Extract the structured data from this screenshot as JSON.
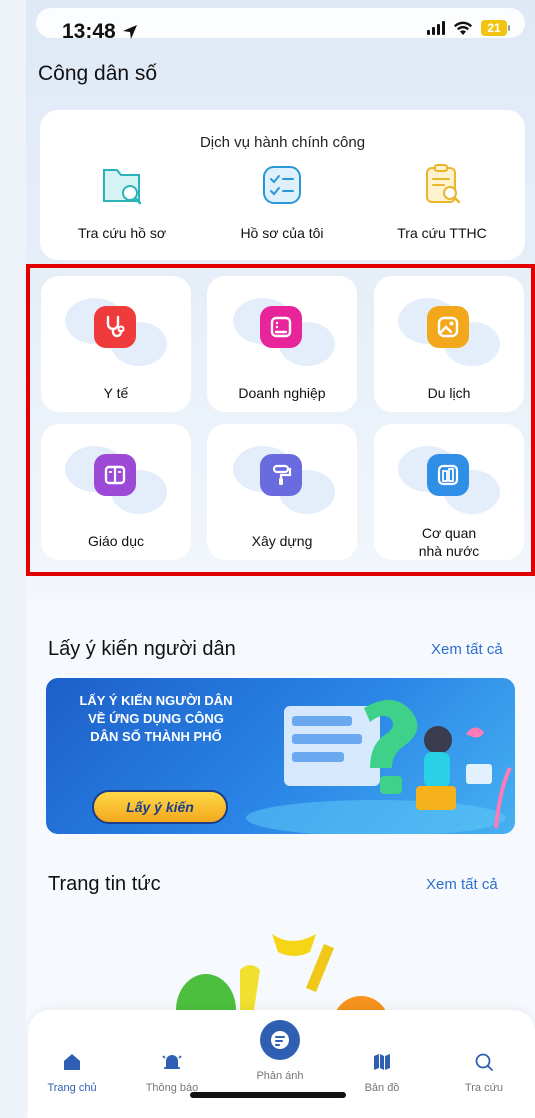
{
  "status_bar": {
    "time": "13:48",
    "battery": "21"
  },
  "header": {
    "title": "Công dân số"
  },
  "public_services": {
    "title": "Dịch vụ hành chính công",
    "items": [
      {
        "label": "Tra cứu hồ sơ",
        "icon": "folder-search-icon"
      },
      {
        "label": "Hồ sơ của tôi",
        "icon": "checklist-icon"
      },
      {
        "label": "Tra cứu TTHC",
        "icon": "clipboard-search-icon"
      }
    ]
  },
  "categories": [
    {
      "label": "Y tế",
      "icon": "stethoscope-icon",
      "color": "#ef3b3b"
    },
    {
      "label": "Doanh nghiệp",
      "icon": "building-card-icon",
      "color": "#e8249a"
    },
    {
      "label": "Du lịch",
      "icon": "picture-icon",
      "color": "#f3a81b"
    },
    {
      "label": "Giáo dục",
      "icon": "book-icon",
      "color": "#9b49d6"
    },
    {
      "label": "Xây dựng",
      "icon": "paint-roller-icon",
      "color": "#6b6be0"
    },
    {
      "label": "Cơ quan nhà nước",
      "label_line1": "Cơ quan",
      "label_line2": "nhà nước",
      "icon": "office-building-icon",
      "color": "#2f8fe6"
    }
  ],
  "survey": {
    "title": "Lấy ý kiến người dân",
    "see_all": "Xem tất cả",
    "banner": {
      "line1": "LẤY Ý KIẾN NGƯỜI DÂN",
      "line2": "VỀ ỨNG DỤNG CÔNG",
      "line3": "DÂN SỐ THÀNH PHỐ",
      "button": "Lấy ý kiến"
    }
  },
  "news": {
    "title": "Trang tin tức",
    "see_all": "Xem tất cả"
  },
  "tab_bar": {
    "items": [
      {
        "label": "Trang chủ",
        "icon": "home-icon",
        "active": true
      },
      {
        "label": "Thông báo",
        "icon": "bell-icon",
        "active": false
      },
      {
        "label": "Phản ánh",
        "icon": "feedback-icon",
        "active": false
      },
      {
        "label": "Bản đồ",
        "icon": "map-icon",
        "active": false
      },
      {
        "label": "Tra cứu",
        "icon": "search-icon",
        "active": false
      }
    ]
  },
  "colors": {
    "accent": "#2f5fb3",
    "highlight_border": "#e00000",
    "link": "#2f6fd1"
  }
}
